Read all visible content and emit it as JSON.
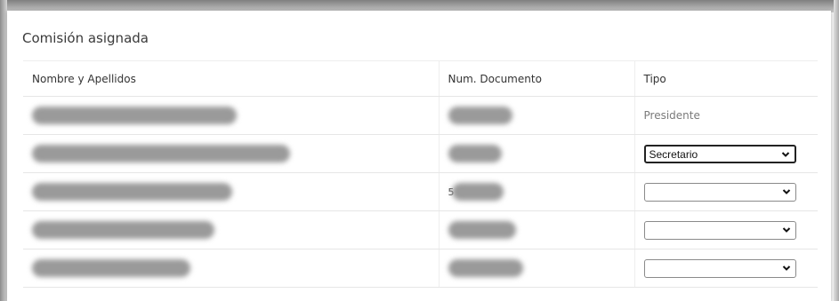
{
  "card": {
    "title": "Comisión asignada"
  },
  "table": {
    "headers": [
      "Nombre y Apellidos",
      "Num. Documento",
      "Tipo"
    ],
    "rows": [
      {
        "tipo_text": "Presidente",
        "tipo_select": null,
        "doc_prefix": ""
      },
      {
        "tipo_text": null,
        "tipo_select": "Secretario",
        "doc_prefix": ""
      },
      {
        "tipo_text": null,
        "tipo_select": "",
        "doc_prefix": "5"
      },
      {
        "tipo_text": null,
        "tipo_select": "",
        "doc_prefix": ""
      },
      {
        "tipo_text": null,
        "tipo_select": "",
        "doc_prefix": ""
      }
    ]
  },
  "icons": {
    "select_arrow": "chevron-down-icon"
  }
}
